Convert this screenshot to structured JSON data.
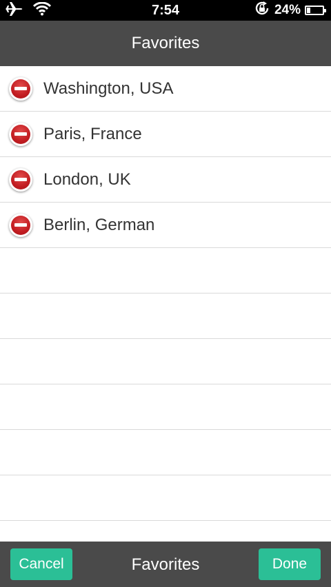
{
  "status_bar": {
    "time": "7:54",
    "battery_percent_label": "24%",
    "battery_level": 0.24,
    "icons": [
      "airplane-icon",
      "wifi-icon",
      "rotation-lock-icon",
      "battery-icon"
    ]
  },
  "header": {
    "title": "Favorites"
  },
  "favorites": [
    {
      "label": "Washington, USA"
    },
    {
      "label": "Paris, France"
    },
    {
      "label": "London, UK"
    },
    {
      "label": "Berlin, German"
    }
  ],
  "empty_rows": 6,
  "toolbar": {
    "cancel_label": "Cancel",
    "title": "Favorites",
    "done_label": "Done"
  },
  "colors": {
    "bar_background": "#4a4a4a",
    "accent_button": "#2bbf96",
    "delete_red": "#c21d22",
    "separator": "#d9d9d9"
  }
}
